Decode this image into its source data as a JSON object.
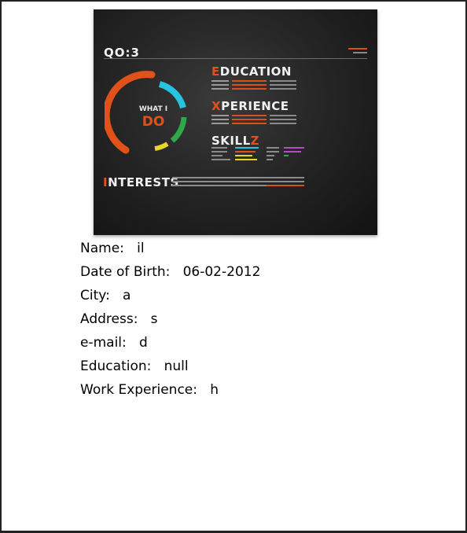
{
  "poster": {
    "logo": "QO:3",
    "what_label": "WHAT I",
    "do_label": "DO",
    "education": {
      "first": "E",
      "rest": "DUCATION"
    },
    "experience": {
      "first": "X",
      "rest": "PERIENCE"
    },
    "skills": {
      "main": "SKILL",
      "tail": "Z"
    },
    "interests": {
      "first": "I",
      "rest": "NTERESTS"
    },
    "ring_colors": [
      "#e1521a",
      "#27c4e0",
      "#2fa84a",
      "#e8d52a"
    ]
  },
  "profile": {
    "fields": [
      {
        "label": "Name:",
        "value": "il"
      },
      {
        "label": "Date of Birth:",
        "value": "06-02-2012"
      },
      {
        "label": "City:",
        "value": "a"
      },
      {
        "label": "Address:",
        "value": "s"
      },
      {
        "label": "e-mail:",
        "value": "d"
      },
      {
        "label": "Education:",
        "value": "null"
      },
      {
        "label": "Work Experience:",
        "value": "h"
      }
    ]
  }
}
